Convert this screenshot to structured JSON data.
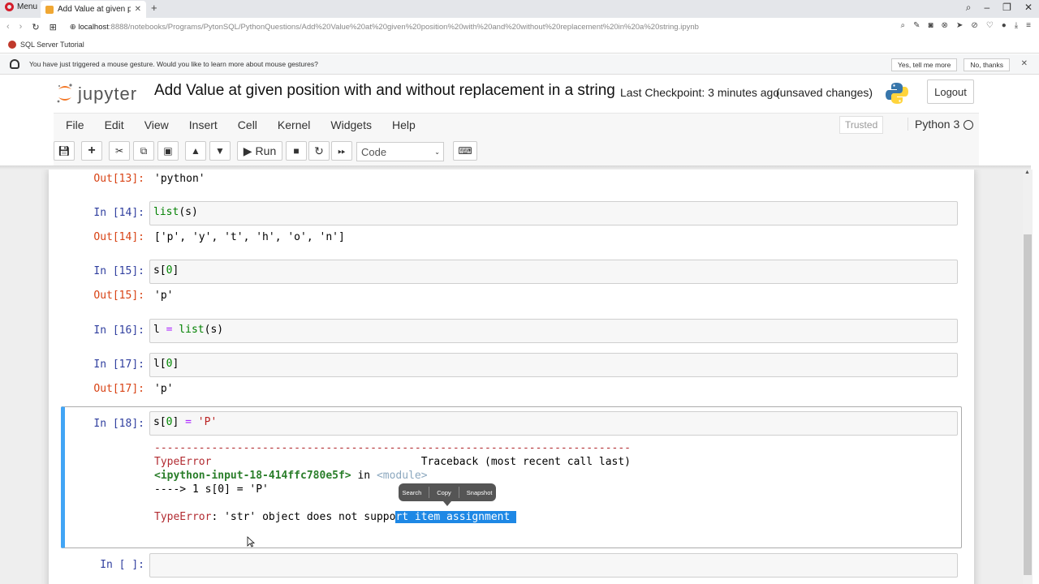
{
  "browser": {
    "menu_label": "Menu",
    "tab_title": "Add Value at given positio",
    "url_host": "localhost",
    "url_rest": ":8888/notebooks/Programs/PytonSQL/PythonQuestions/Add%20Value%20at%20given%20position%20with%20and%20without%20replacement%20in%20a%20string.ipynb",
    "bookmark": "SQL Server Tutorial",
    "gesture_message": "You have just triggered a mouse gesture. Would you like to learn more about mouse gestures?",
    "gesture_yes": "Yes, tell me more",
    "gesture_no": "No, thanks"
  },
  "jupyter": {
    "logo_text": "jupyter",
    "notebook_title": "Add Value at given position with and without replacement in a string",
    "checkpoint": "Last Checkpoint: 3 minutes ago",
    "status": "(unsaved changes)",
    "logout": "Logout",
    "menus": [
      "File",
      "Edit",
      "View",
      "Insert",
      "Cell",
      "Kernel",
      "Widgets",
      "Help"
    ],
    "trusted": "Trusted",
    "kernel": "Python 3",
    "run_label": "Run",
    "cell_type": "Code"
  },
  "cells": {
    "c13": {
      "out_prompt": "Out[13]:",
      "output": "'python'"
    },
    "c14": {
      "in_prompt": "In [14]:",
      "code_fn": "list",
      "code_arg": "(s)",
      "out_prompt": "Out[14]:",
      "output": "['p', 'y', 't', 'h', 'o', 'n']"
    },
    "c15": {
      "in_prompt": "In [15]:",
      "code_var": "s[",
      "code_idx": "0",
      "code_end": "]",
      "out_prompt": "Out[15]:",
      "output": "'p'"
    },
    "c16": {
      "in_prompt": "In [16]:",
      "code_lhs": "l ",
      "code_op": "=",
      "code_fn": " list",
      "code_arg": "(s)"
    },
    "c17": {
      "in_prompt": "In [17]:",
      "code_var": "l[",
      "code_idx": "0",
      "code_end": "]",
      "out_prompt": "Out[17]:",
      "output": "'p'"
    },
    "c18": {
      "in_prompt": "In [18]:",
      "code_var": "s[",
      "code_idx": "0",
      "code_mid": "] ",
      "code_op": "=",
      "code_str": " 'P'",
      "dashes": "---------------------------------------------------------------------------",
      "err_type": "TypeError",
      "traceback_header": "                                 Traceback (most recent call last)",
      "err_location": "<ipython-input-18-414ffc780e5f>",
      "err_in": " in ",
      "err_module": "<module>",
      "err_arrow": "----> 1 s[0] = 'P'",
      "err_msg_prefix": "TypeError",
      "err_msg_plain": ": 'str' object does not suppo",
      "err_msg_selected": "rt item assignment "
    },
    "empty": {
      "in_prompt": "In [ ]:"
    }
  },
  "context_menu": {
    "search": "Search",
    "copy": "Copy",
    "snapshot": "Snapshot"
  }
}
